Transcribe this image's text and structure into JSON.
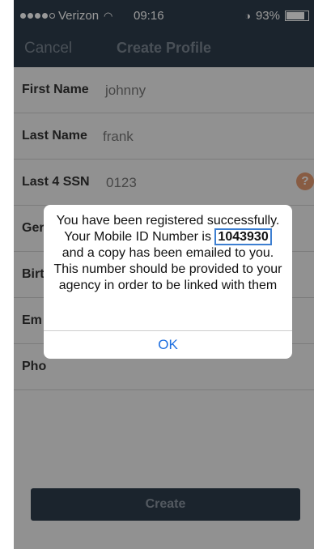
{
  "status_bar": {
    "carrier": "Verizon",
    "time": "09:16",
    "battery": "93%",
    "battery_level": 0.93
  },
  "nav": {
    "cancel_label": "Cancel",
    "title": "Create Profile"
  },
  "form": {
    "first_name": {
      "label": "First Name",
      "value": "johnny"
    },
    "last_name": {
      "label": "Last Name",
      "value": "frank"
    },
    "last4_ssn": {
      "label": "Last 4 SSN",
      "value": "0123"
    },
    "gender": {
      "label": "Ger"
    },
    "birth": {
      "label": "Birt"
    },
    "email": {
      "label": "Em"
    },
    "phone": {
      "label": "Pho"
    },
    "help_icon": "question-mark"
  },
  "create_label": "Create",
  "alert": {
    "message_before": "You have been registered successfully. Your Mobile ID Number is",
    "mobile_id": "1043930",
    "message_after": "and a copy has been emailed to you. This number should be provided to your agency in order to be linked with them",
    "ok_label": "OK"
  },
  "colors": {
    "navbar": "#2e3d4c",
    "ok_blue": "#1e6fe0",
    "help_orange": "#e39a70",
    "id_highlight": "#3d7fd1"
  }
}
